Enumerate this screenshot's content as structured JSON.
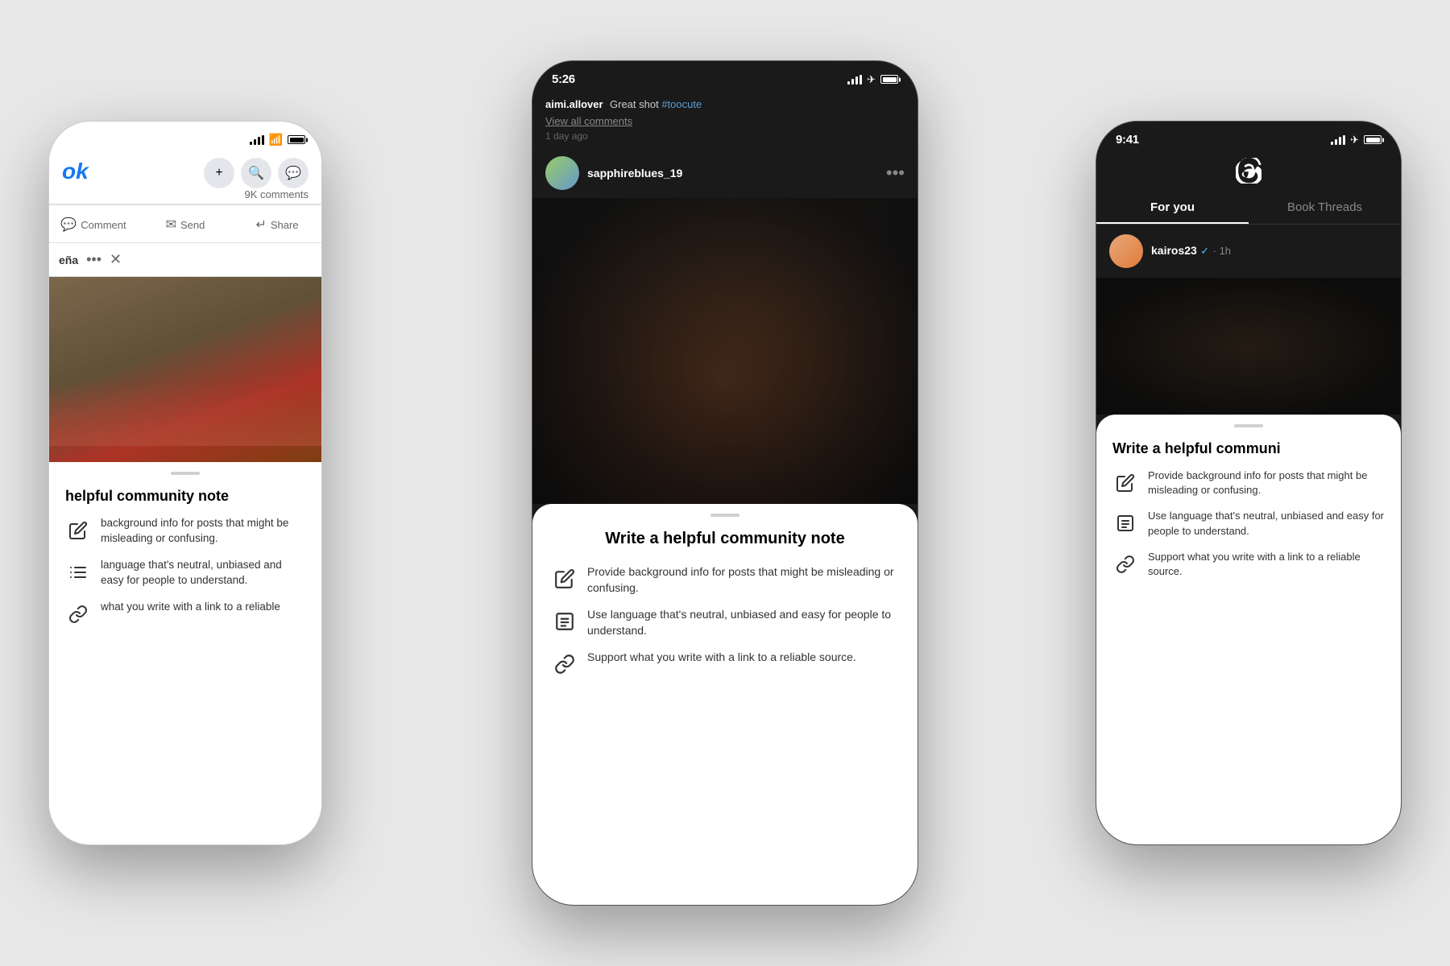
{
  "background": "#e8e8e8",
  "phones": {
    "left": {
      "app": "Facebook",
      "platform": "light",
      "status_time": "",
      "logo": "ok",
      "comments_count": "9K comments",
      "actions": [
        "Comment",
        "Send",
        "Share"
      ],
      "panel_title": "eña",
      "image_alt": "sports image blurred",
      "sheet": {
        "handle": true,
        "title_partial": "helpful community note",
        "items": [
          "background info for posts that might be misleading or confusing.",
          "language that's neutral, unbiased and easy for people to understand.",
          "what you write with a link to a reliable"
        ]
      }
    },
    "center": {
      "app": "Instagram",
      "platform": "dark",
      "status_time": "5:26",
      "caption_user": "aimi.allover",
      "caption_text": "Great shot #toocute",
      "view_comments": "View all comments",
      "time_ago": "1 day ago",
      "username": "sapphireblues_19",
      "image_alt": "blurred dark photo",
      "sheet": {
        "handle": true,
        "title": "Write a helpful community note",
        "items": [
          {
            "icon": "edit",
            "text": "Provide background info for posts that might be misleading or confusing."
          },
          {
            "icon": "list",
            "text": "Use language that's neutral, unbiased and easy for people to understand."
          },
          {
            "icon": "link",
            "text": "Support what you write with a link to a reliable source."
          }
        ]
      }
    },
    "right": {
      "app": "Threads",
      "platform": "dark",
      "status_time": "9:41",
      "tabs": [
        "For you",
        "Book Threads"
      ],
      "active_tab": "For you",
      "username": "kairos23",
      "verified": true,
      "time": "1h",
      "sheet": {
        "handle": true,
        "title_partial": "Write a helpful communi",
        "items": [
          "Provide background info for posts that might be misleading or confusing.",
          "Use language that's neutral, unbiased and easy for people to understand.",
          "Support what you write with a link to a reliable source."
        ],
        "icons": [
          "edit",
          "list",
          "link"
        ]
      }
    }
  }
}
